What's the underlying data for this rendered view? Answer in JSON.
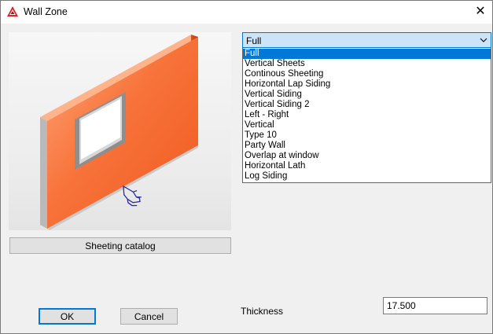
{
  "window": {
    "title": "Wall Zone",
    "close_glyph": "✕"
  },
  "icons": {
    "app": "app-logo-icon",
    "close": "close-icon",
    "chevron": "chevron-down-icon",
    "cursor": "hand-pointer-icon"
  },
  "preview": {
    "image": "orange-wall-with-window-render"
  },
  "buttons": {
    "catalog": "Sheeting catalog",
    "ok": "OK",
    "cancel": "Cancel"
  },
  "sheeting_type": {
    "selected": "Full",
    "options": [
      "Full",
      "Vertical Sheets",
      "Continous Sheeting",
      "Horizontal Lap Siding",
      "Vertical Siding",
      "Vertical Siding 2",
      "Left - Right",
      "Vertical",
      "Type 10",
      "Party Wall",
      "Overlap at window",
      "Horizontal Lath",
      "Log Siding"
    ]
  },
  "thickness": {
    "label": "Thickness",
    "value": "17.500"
  },
  "colors": {
    "accent": "#0078d7",
    "wall_orange": "#f26a2e",
    "wall_orange_light": "#ff9a6a"
  }
}
